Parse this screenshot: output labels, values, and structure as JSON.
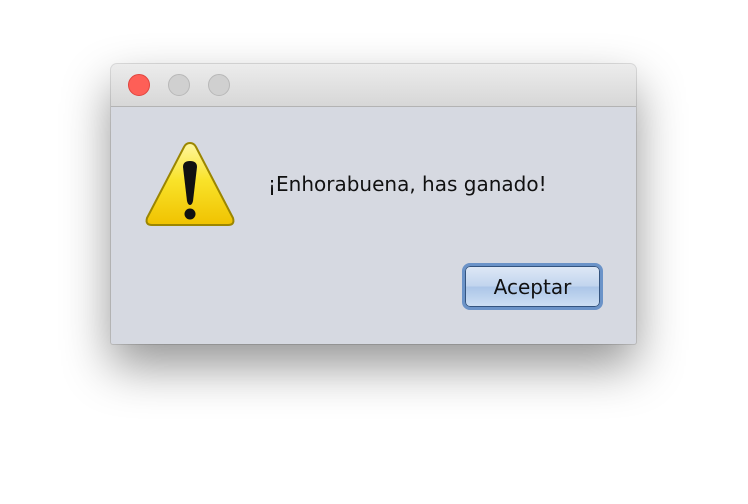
{
  "dialog": {
    "message": "¡Enhorabuena, has ganado!",
    "icon": "warning-icon",
    "buttons": {
      "ok_label": "Aceptar"
    }
  },
  "colors": {
    "dialog_bg": "#d6d9e1",
    "close_button": "#fe5f57",
    "inactive_buttons": "#d0d0d0",
    "warning_fill": "#f6d60f",
    "button_border": "#6b93c8"
  }
}
